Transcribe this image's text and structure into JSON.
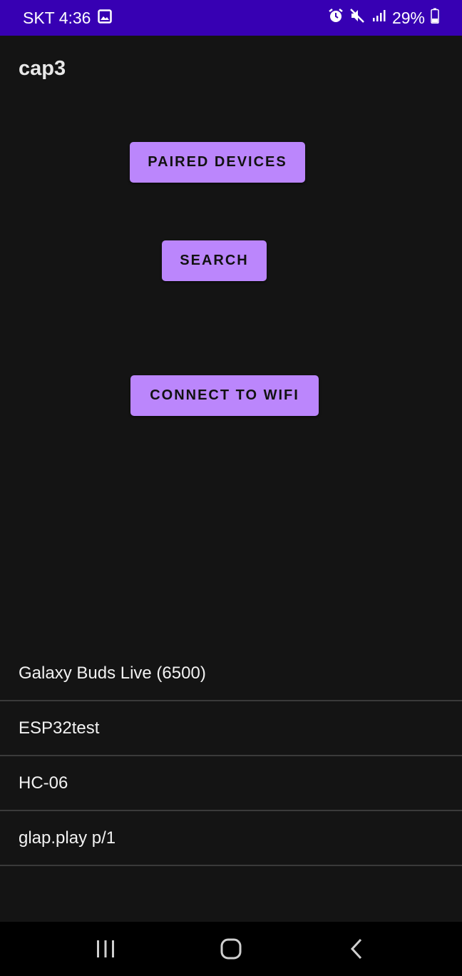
{
  "status_bar": {
    "carrier_time": "SKT 4:36",
    "battery_percent": "29%",
    "icons": [
      "gallery-icon",
      "alarm-icon",
      "mute-icon",
      "signal-icon",
      "battery-icon"
    ]
  },
  "app": {
    "title": "cap3"
  },
  "buttons": {
    "paired_devices": "PAIRED DEVICES",
    "search": "SEARCH",
    "connect_wifi": "CONNECT TO WIFI"
  },
  "devices": [
    {
      "name": "Galaxy Buds Live (6500)"
    },
    {
      "name": "ESP32test"
    },
    {
      "name": "HC-06"
    },
    {
      "name": "glap.play p/1"
    }
  ],
  "nav": {
    "icons": [
      "recent-apps-icon",
      "home-icon",
      "back-icon"
    ]
  },
  "colors": {
    "status_bar": "#3700b3",
    "background": "#141414",
    "button": "#bb86fc",
    "nav_bar": "#000000"
  }
}
